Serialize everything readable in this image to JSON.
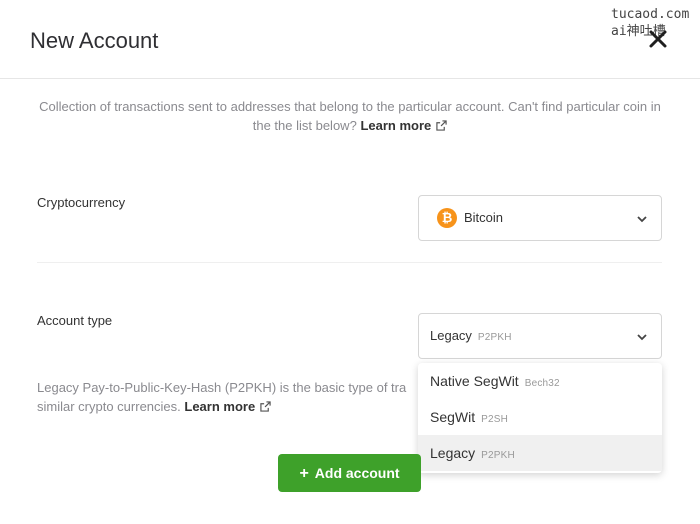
{
  "header": {
    "title": "New Account",
    "close_icon": "close-x-icon",
    "watermark_line1": "tucaod.com",
    "watermark_line2": "ai神吐槽"
  },
  "intro": {
    "text": "Collection of transactions sent to addresses that belong to the particular account. Can't find particular coin in the the list below?",
    "link": "Learn more",
    "link_icon": "external-link-icon"
  },
  "cryptocurrency": {
    "label": "Cryptocurrency",
    "selected": "Bitcoin",
    "selected_icon": "bitcoin-icon",
    "icon_color": "#f7931a"
  },
  "account_type": {
    "label": "Account type",
    "selected": "Legacy",
    "selected_tag": "P2PKH",
    "description_line1": "Legacy Pay-to-Public-Key-Hash (P2PKH) is the basic type of tra",
    "description_line2": "similar crypto currencies.",
    "description_link": "Learn more",
    "options": [
      {
        "label": "Native SegWit",
        "tag": "Bech32"
      },
      {
        "label": "SegWit",
        "tag": "P2SH"
      },
      {
        "label": "Legacy",
        "tag": "P2PKH"
      }
    ]
  },
  "actions": {
    "add_label": "Add account",
    "add_icon": "plus-icon",
    "accent_color": "#3ea12a"
  }
}
